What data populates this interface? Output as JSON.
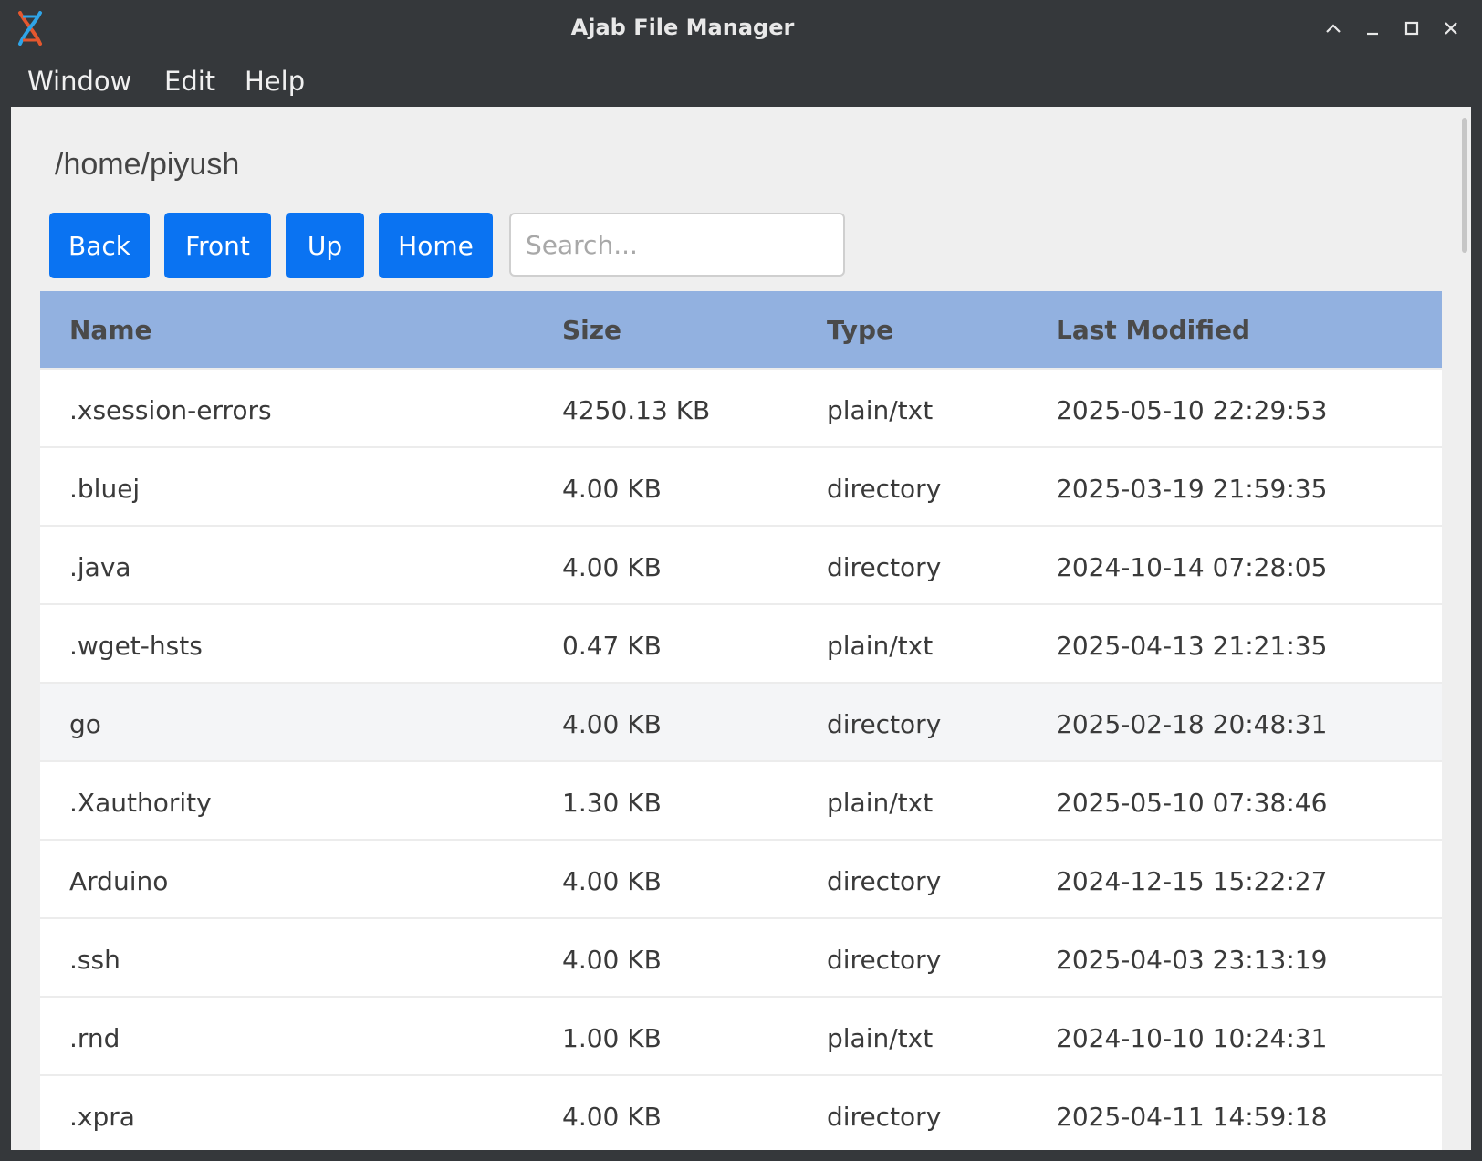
{
  "window": {
    "title": "Ajab File Manager",
    "controls": [
      "chevron-up-icon",
      "minimize-icon",
      "maximize-icon",
      "close-icon"
    ]
  },
  "menu": {
    "items": [
      "Window",
      "Edit",
      "Help"
    ]
  },
  "toolbar": {
    "path": "/home/piyush",
    "back_label": "Back",
    "front_label": "Front",
    "up_label": "Up",
    "home_label": "Home",
    "search_placeholder": "Search...",
    "search_value": ""
  },
  "colors": {
    "accent": "#0a73f2",
    "header_bg": "#92b1e0",
    "titlebar_bg": "#35383b"
  },
  "table": {
    "columns": [
      "Name",
      "Size",
      "Type",
      "Last Modified"
    ],
    "rows": [
      {
        "name": ".xsession-errors",
        "size": "4250.13 KB",
        "type": "plain/txt",
        "modified": "2025-05-10 22:29:53"
      },
      {
        "name": ".bluej",
        "size": "4.00 KB",
        "type": "directory",
        "modified": "2025-03-19 21:59:35"
      },
      {
        "name": ".java",
        "size": "4.00 KB",
        "type": "directory",
        "modified": "2024-10-14 07:28:05"
      },
      {
        "name": ".wget-hsts",
        "size": "0.47 KB",
        "type": "plain/txt",
        "modified": "2025-04-13 21:21:35"
      },
      {
        "name": "go",
        "size": "4.00 KB",
        "type": "directory",
        "modified": "2025-02-18 20:48:31"
      },
      {
        "name": ".Xauthority",
        "size": "1.30 KB",
        "type": "plain/txt",
        "modified": "2025-05-10 07:38:46"
      },
      {
        "name": "Arduino",
        "size": "4.00 KB",
        "type": "directory",
        "modified": "2024-12-15 15:22:27"
      },
      {
        "name": ".ssh",
        "size": "4.00 KB",
        "type": "directory",
        "modified": "2025-04-03 23:13:19"
      },
      {
        "name": ".rnd",
        "size": "1.00 KB",
        "type": "plain/txt",
        "modified": "2024-10-10 10:24:31"
      },
      {
        "name": ".xpra",
        "size": "4.00 KB",
        "type": "directory",
        "modified": "2025-04-11 14:59:18"
      }
    ]
  }
}
